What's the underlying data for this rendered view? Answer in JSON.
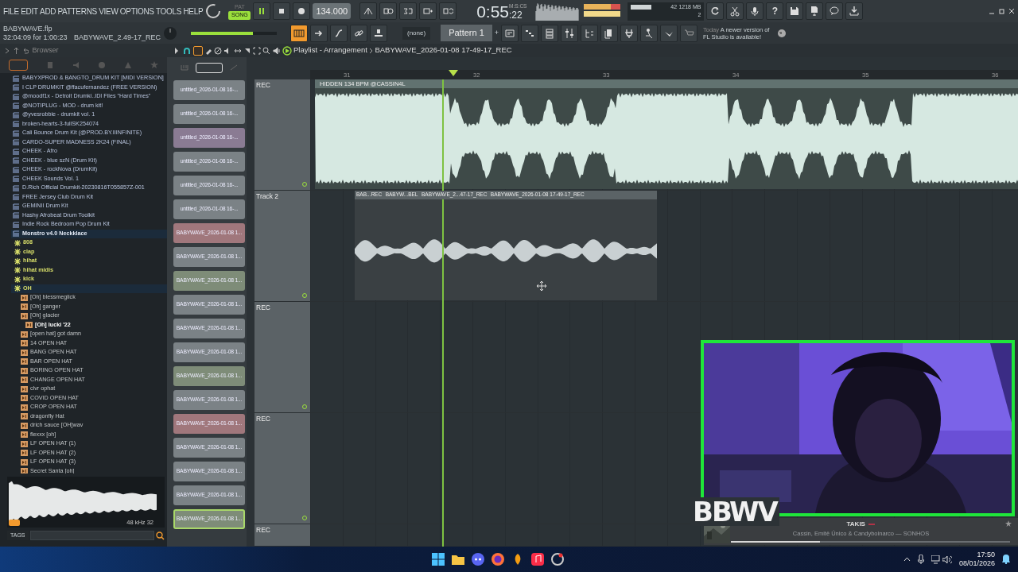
{
  "menu": [
    "FILE",
    "EDIT",
    "ADD",
    "PATTERNS",
    "VIEW",
    "OPTIONS",
    "TOOLS",
    "HELP"
  ],
  "transport": {
    "pat_label": "PAT",
    "song_label": "SONG",
    "song_selected": true,
    "tempo": "134.000",
    "time": "0:55",
    "time_fraction": ":22",
    "time_units": "M:S:CS"
  },
  "monitor": {
    "cpu": "42",
    "memory": "1218 MB",
    "polyphony": "2"
  },
  "help_label": "?",
  "project": {
    "file": "BABYWAVE.flp",
    "position": "32:04:09 for 1:00:23",
    "recording": "BABYWAVE_2.49-17_REC"
  },
  "master_volume": {
    "level": 0.72
  },
  "pattern": {
    "channel": "(none)",
    "name": "Pattern 1",
    "add_label": "+"
  },
  "news": {
    "when": "Today",
    "text": "A newer version of FL Studio is available!"
  },
  "browser": {
    "title": "Browser",
    "tree": [
      {
        "name": "BABYXPROD & BANGTO_DRUM KIT [MIDI VERSION]",
        "kind": "kit",
        "expanded": false
      },
      {
        "name": "I CLP DRUMKIT @ffacufernandez (FREE VERSION)",
        "kind": "kit",
        "expanded": false
      },
      {
        "name": "@moodf1x - Detroit Drumki..IDI Files \"Hard Times\"",
        "kind": "kit",
        "expanded": false
      },
      {
        "name": "@NOTIPLUG - MOD - drum kit!",
        "kind": "kit",
        "expanded": false
      },
      {
        "name": "@yvesrobbie - drumkit vol. 1",
        "kind": "kit",
        "expanded": false
      },
      {
        "name": "broken-hearts-3-fullSK254074",
        "kind": "kit",
        "expanded": false
      },
      {
        "name": "Cali Bounce Drum Kit (@PROD.BY.IIINFINITE)",
        "kind": "kit",
        "expanded": false
      },
      {
        "name": "CARDO-SUPER MADNESS 2K24 (FINAL)",
        "kind": "kit",
        "expanded": false
      },
      {
        "name": "CHEEK - Afro",
        "kind": "kit",
        "expanded": false
      },
      {
        "name": "CHEEK - blue szN (Drum Kit)",
        "kind": "kit",
        "expanded": false
      },
      {
        "name": "CHEEK - rockNova (DrumKit)",
        "kind": "kit",
        "expanded": false
      },
      {
        "name": "CHEEK Sounds Vol. 1",
        "kind": "kit",
        "expanded": false
      },
      {
        "name": "D.Rich Official Drumkit-20230816T055857Z-001",
        "kind": "kit",
        "expanded": false
      },
      {
        "name": "FREE Jersey Club Drum Kit",
        "kind": "kit",
        "expanded": false
      },
      {
        "name": "GEMINII Drum Kit",
        "kind": "kit",
        "expanded": false
      },
      {
        "name": "Hashy Afrobeat Drum Toolkit",
        "kind": "kit",
        "expanded": false
      },
      {
        "name": "Indie Rock Bedroom Pop Drum Kit",
        "kind": "kit",
        "expanded": false
      },
      {
        "name": "Monstro v4.0 Neckklace",
        "kind": "kit",
        "expanded": true,
        "children": [
          {
            "name": "808",
            "kind": "folder",
            "expanded": false
          },
          {
            "name": "clap",
            "kind": "folder",
            "expanded": false
          },
          {
            "name": "hihat",
            "kind": "folder",
            "expanded": false
          },
          {
            "name": "hihat midis",
            "kind": "folder",
            "expanded": false
          },
          {
            "name": "kick",
            "kind": "folder",
            "expanded": false
          },
          {
            "name": "OH",
            "kind": "folder",
            "expanded": true,
            "children": [
              {
                "name": "[Oh] blessmeglick",
                "kind": "sample",
                "selected": false
              },
              {
                "name": "[Oh] ganger",
                "kind": "sample",
                "selected": false
              },
              {
                "name": "[Oh] glacier",
                "kind": "sample",
                "selected": false
              },
              {
                "name": "[Oh] lucki '22",
                "kind": "sample",
                "selected": true
              },
              {
                "name": "[open hat] got damn",
                "kind": "sample",
                "selected": false
              },
              {
                "name": "14 OPEN HAT",
                "kind": "sample",
                "selected": false
              },
              {
                "name": "BANG OPEN HAT",
                "kind": "sample",
                "selected": false
              },
              {
                "name": "BAR OPEN HAT",
                "kind": "sample",
                "selected": false
              },
              {
                "name": "BORING OPEN HAT",
                "kind": "sample",
                "selected": false
              },
              {
                "name": "CHANGE OPEN HAT",
                "kind": "sample",
                "selected": false
              },
              {
                "name": "clvr ophat",
                "kind": "sample",
                "selected": false
              },
              {
                "name": "COVID OPEN HAT",
                "kind": "sample",
                "selected": false
              },
              {
                "name": "CROP OPEN HAT",
                "kind": "sample",
                "selected": false
              },
              {
                "name": "dragonfly Hat",
                "kind": "sample",
                "selected": false
              },
              {
                "name": "drich sauce [OH]wav",
                "kind": "sample",
                "selected": false
              },
              {
                "name": "flexxx [oh]",
                "kind": "sample",
                "selected": false
              },
              {
                "name": "LF OPEN HAT (1)",
                "kind": "sample",
                "selected": false
              },
              {
                "name": "LF OPEN HAT (2)",
                "kind": "sample",
                "selected": false
              },
              {
                "name": "LF OPEN HAT (3)",
                "kind": "sample",
                "selected": false
              },
              {
                "name": "Secret Santa [oh]",
                "kind": "sample",
                "selected": false
              }
            ]
          }
        ]
      }
    ],
    "preview": {
      "rate": "48 kHz",
      "bits": "32"
    },
    "tags_label": "TAGS"
  },
  "playlist": {
    "title": "Playlist - Arrangement",
    "path": "BABYWAVE_2026-01-08 17-49-17_REC",
    "ruler": [
      "31",
      "32",
      "33",
      "34",
      "35",
      "36"
    ],
    "clip_list": [
      {
        "name": "untitled_2026-01-08 16-...",
        "color": "#7b8286",
        "selected": false
      },
      {
        "name": "untitled_2026-01-08 16-...",
        "color": "#7b8286",
        "selected": false
      },
      {
        "name": "untitled_2026-01-08 16-...",
        "color": "#8a7b93",
        "selected": false
      },
      {
        "name": "untitled_2026-01-08 16-...",
        "color": "#7b8286",
        "selected": false
      },
      {
        "name": "untitled_2026-01-08 16-...",
        "color": "#7b8286",
        "selected": false
      },
      {
        "name": "untitled_2026-01-08 16-...",
        "color": "#7b8286",
        "selected": false
      },
      {
        "name": "BABYWAVE_2026-01-08 1...",
        "color": "#a0777c",
        "selected": false
      },
      {
        "name": "BABYWAVE_2026-01-08 1...",
        "color": "#7b8286",
        "selected": false
      },
      {
        "name": "BABYWAVE_2026-01-08 1...",
        "color": "#7e8c78",
        "selected": false
      },
      {
        "name": "BABYWAVE_2026-01-08 1...",
        "color": "#7b8286",
        "selected": false
      },
      {
        "name": "BABYWAVE_2026-01-08 1...",
        "color": "#7b8286",
        "selected": false
      },
      {
        "name": "BABYWAVE_2026-01-08 1...",
        "color": "#7b8286",
        "selected": false
      },
      {
        "name": "BABYWAVE_2026-01-08 1...",
        "color": "#7e8c78",
        "selected": false
      },
      {
        "name": "BABYWAVE_2026-01-08 1...",
        "color": "#7b8286",
        "selected": false
      },
      {
        "name": "BABYWAVE_2026-01-08 1...",
        "color": "#a0777c",
        "selected": false
      },
      {
        "name": "BABYWAVE_2026-01-08 1...",
        "color": "#7b8286",
        "selected": false
      },
      {
        "name": "BABYWAVE_2026-01-08 1...",
        "color": "#7b8286",
        "selected": false
      },
      {
        "name": "BABYWAVE_2026-01-08 1...",
        "color": "#7b8286",
        "selected": false
      },
      {
        "name": "BABYWAVE_2026-01-08 1...",
        "color": "#7e8c78",
        "selected": true
      }
    ],
    "tracks": [
      {
        "name": "REC",
        "clip": {
          "kind": "full",
          "labels": [
            "HIDDEN 134 BPM @CASSIN4L"
          ]
        }
      },
      {
        "name": "Track 2",
        "clip": {
          "kind": "short",
          "labels": [
            "BAB...REC",
            "BABYW...BEL",
            "BABYWAVE_2...47-17_REC",
            "BABYWAVE_2026-01-08 17-49-17_REC"
          ]
        }
      },
      {
        "name": "REC"
      },
      {
        "name": "REC"
      },
      {
        "name": "REC"
      }
    ]
  },
  "stream": {
    "logo": "BBWV"
  },
  "now_playing": {
    "title": "TAKIS",
    "artist": "Cassin, Emitê Único & Candyboinarco — SONHOS",
    "level": 0.32
  },
  "taskbar": {
    "time": "17:50",
    "date": "08/01/2026"
  }
}
